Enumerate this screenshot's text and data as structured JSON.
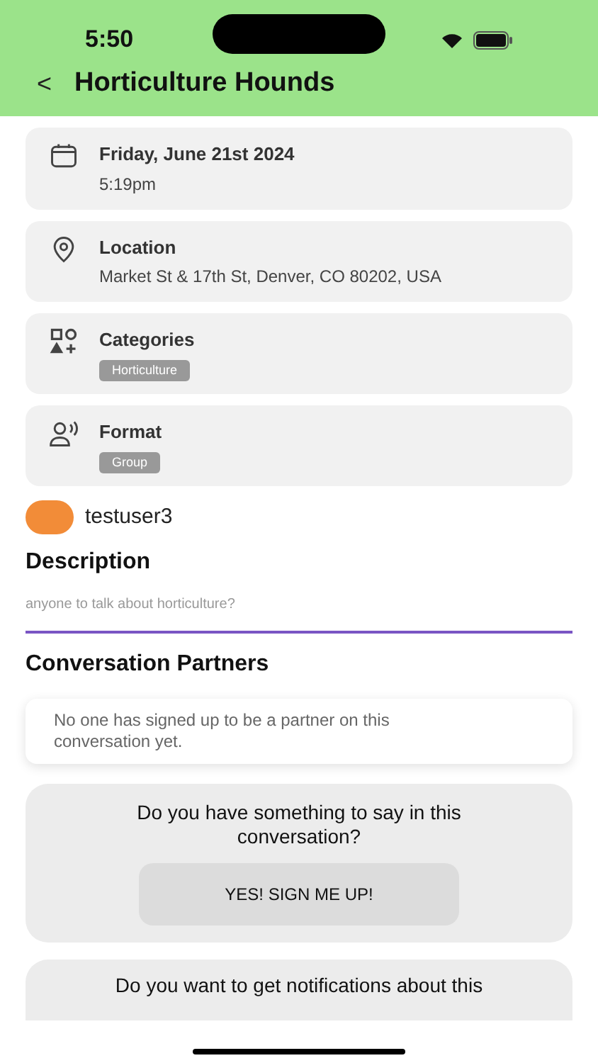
{
  "status_bar": {
    "time": "5:50"
  },
  "header": {
    "back": "<",
    "title": "Horticulture Hounds"
  },
  "info_cards": [
    {
      "kind": "date",
      "title": "Friday, June 21st 2024",
      "subtitle": "5:19pm"
    },
    {
      "kind": "location",
      "title": "Location",
      "subtitle": "Market St & 17th St, Denver, CO 80202, USA"
    },
    {
      "kind": "categories",
      "title": "Categories",
      "tags": [
        "Horticulture"
      ]
    },
    {
      "kind": "format",
      "title": "Format",
      "tags": [
        "Group"
      ]
    }
  ],
  "host": {
    "username": "testuser3",
    "color": "#f28c38"
  },
  "description": {
    "heading": "Description",
    "text": "anyone to talk about horticulture?"
  },
  "partners": {
    "heading": "Conversation Partners",
    "empty_message": "No one has signed up to be a partner on this conversation yet."
  },
  "signup_card": {
    "question": "Do you have something to say in this conversation?",
    "button": "YES! SIGN ME UP!"
  },
  "notify_card": {
    "question": "Do you want to get notifications about this"
  }
}
